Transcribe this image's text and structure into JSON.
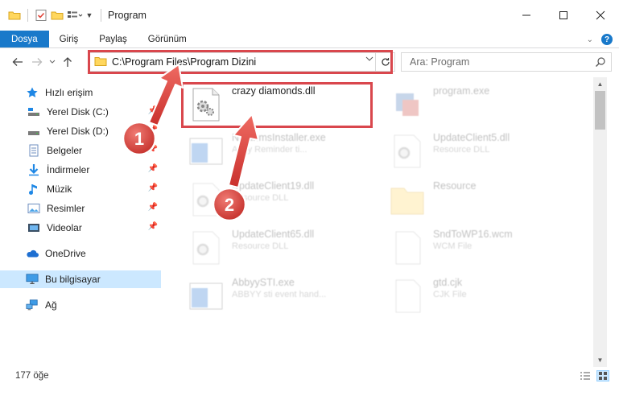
{
  "window": {
    "title": "Program"
  },
  "ribbon": {
    "tabs": [
      "Dosya",
      "Giriş",
      "Paylaş",
      "Görünüm"
    ],
    "help": "?"
  },
  "address": {
    "path": "C:\\Program Files\\Program Dizini"
  },
  "search": {
    "placeholder": "Ara: Program"
  },
  "sidebar": {
    "items": [
      {
        "label": "Hızlı erişim",
        "icon": "star-icon",
        "pinned": false
      },
      {
        "label": "Yerel Disk (C:)",
        "icon": "drive-c-icon",
        "pinned": true
      },
      {
        "label": "Yerel Disk (D:)",
        "icon": "drive-d-icon",
        "pinned": true
      },
      {
        "label": "Belgeler",
        "icon": "documents-icon",
        "pinned": true
      },
      {
        "label": "İndirmeler",
        "icon": "downloads-icon",
        "pinned": true
      },
      {
        "label": "Müzik",
        "icon": "music-icon",
        "pinned": true
      },
      {
        "label": "Resimler",
        "icon": "pictures-icon",
        "pinned": true
      },
      {
        "label": "Videolar",
        "icon": "videos-icon",
        "pinned": true
      },
      {
        "label": "OneDrive",
        "icon": "onedrive-icon",
        "pinned": false
      },
      {
        "label": "Bu bilgisayar",
        "icon": "computer-icon",
        "pinned": false
      },
      {
        "label": "Ağ",
        "icon": "network-icon",
        "pinned": false
      }
    ]
  },
  "files": [
    {
      "name": "crazy diamonds.dll",
      "sub": "",
      "icon": "dll-gear-icon",
      "faded": false
    },
    {
      "name": "program.exe",
      "sub": "",
      "icon": "exe-icon",
      "faded": true
    },
    {
      "name": "NatunmsInstaller.exe",
      "sub": "Abby Reminder ti...",
      "icon": "app-window-icon",
      "faded": true
    },
    {
      "name": "UpdateClient5.dll",
      "sub": "Resource DLL",
      "icon": "dll-gear-icon",
      "faded": true
    },
    {
      "name": "UpdateClient19.dll",
      "sub": "Resource DLL",
      "icon": "dll-gear-icon",
      "faded": true
    },
    {
      "name": "Resource",
      "sub": "",
      "icon": "folder-icon",
      "faded": true
    },
    {
      "name": "UpdateClient65.dll",
      "sub": "Resource DLL",
      "icon": "dll-gear-icon",
      "faded": true
    },
    {
      "name": "SndToWP16.wcm",
      "sub": "WCM File",
      "icon": "blank-file-icon",
      "faded": true
    },
    {
      "name": "AbbyySTI.exe",
      "sub": "ABBYY sti event hand...",
      "icon": "app-window-icon",
      "faded": true
    },
    {
      "name": "gtd.cjk",
      "sub": "CJK File",
      "icon": "blank-file-icon",
      "faded": true
    }
  ],
  "annotations": {
    "callout_1": "1",
    "callout_2": "2",
    "color": "#d9474d"
  },
  "status": {
    "item_count": "177 öğe"
  },
  "colors": {
    "accent": "#1979ca",
    "selection": "#cce8ff"
  }
}
